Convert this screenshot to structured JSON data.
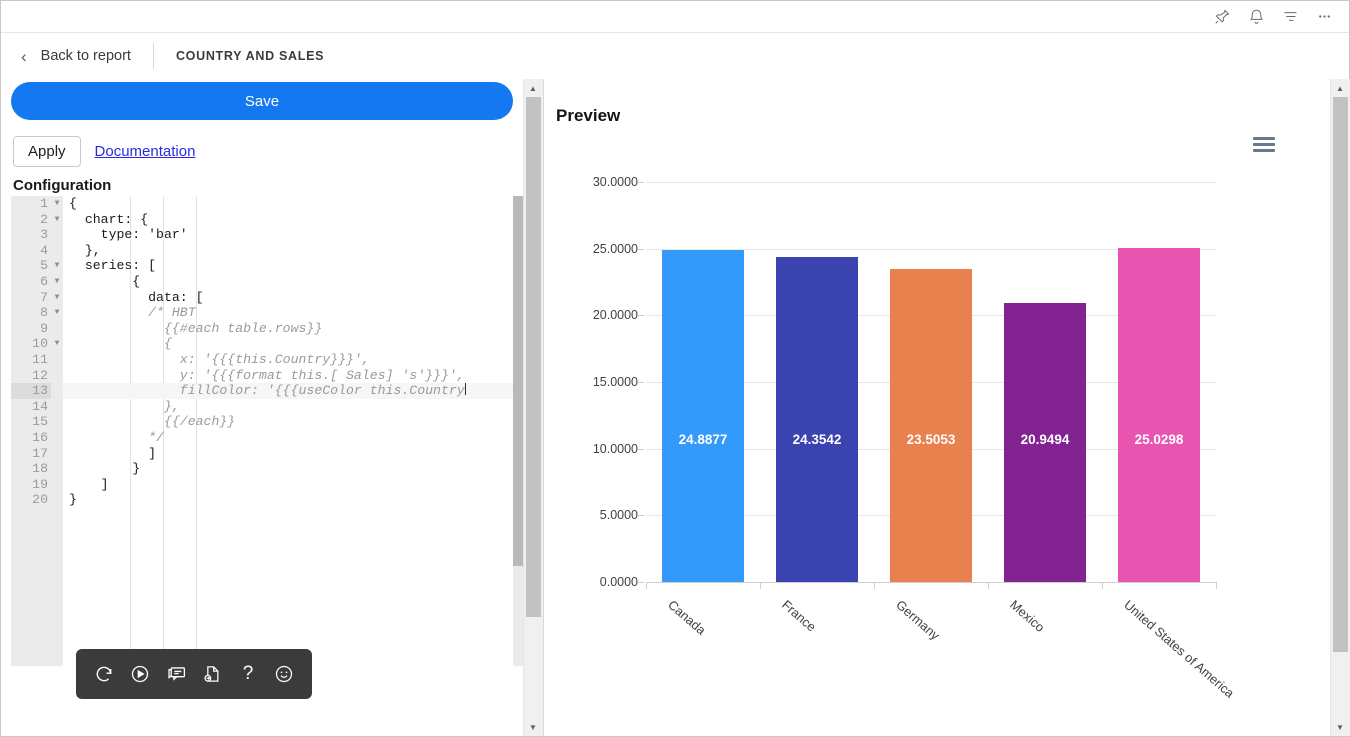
{
  "topbar": {
    "icons": [
      {
        "name": "pin-icon",
        "label": "Pin"
      },
      {
        "name": "bell-icon",
        "label": "Notifications"
      },
      {
        "name": "filter-icon",
        "label": "Filter"
      },
      {
        "name": "more-options-icon",
        "label": "More options"
      }
    ]
  },
  "breadcrumb": {
    "back_label": "Back to report",
    "title": "COUNTRY AND SALES"
  },
  "left_panel": {
    "save_label": "Save",
    "apply_label": "Apply",
    "documentation_label": "Documentation",
    "configuration_label": "Configuration",
    "editor": {
      "active_line": 13,
      "lines": [
        {
          "n": "1",
          "fold": true,
          "text": "{",
          "style": "code"
        },
        {
          "n": "2",
          "fold": true,
          "text": "  chart: {",
          "style": "code"
        },
        {
          "n": "3",
          "fold": false,
          "text": "    type: 'bar'",
          "style": "code"
        },
        {
          "n": "4",
          "fold": false,
          "text": "  },",
          "style": "code"
        },
        {
          "n": "5",
          "fold": true,
          "text": "  series: [",
          "style": "code"
        },
        {
          "n": "6",
          "fold": true,
          "text": "        {",
          "style": "code"
        },
        {
          "n": "7",
          "fold": true,
          "text": "          data: [",
          "style": "code"
        },
        {
          "n": "8",
          "fold": true,
          "text": "          /* HBT",
          "style": "comment"
        },
        {
          "n": "9",
          "fold": false,
          "text": "            {{#each table.rows}}",
          "style": "comment"
        },
        {
          "n": "10",
          "fold": true,
          "text": "            {",
          "style": "comment"
        },
        {
          "n": "11",
          "fold": false,
          "text": "              x: '{{{this.Country}}}',",
          "style": "comment"
        },
        {
          "n": "12",
          "fold": false,
          "text": "              y: '{{{format this.[ Sales] 's'}}}',",
          "style": "comment"
        },
        {
          "n": "13",
          "fold": false,
          "text": "              fillColor: '{{{useColor this.Country",
          "style": "comment"
        },
        {
          "n": "14",
          "fold": false,
          "text": "            },",
          "style": "comment"
        },
        {
          "n": "15",
          "fold": false,
          "text": "            {{/each}}",
          "style": "comment"
        },
        {
          "n": "16",
          "fold": false,
          "text": "          */",
          "style": "comment"
        },
        {
          "n": "17",
          "fold": false,
          "text": "          ]",
          "style": "code"
        },
        {
          "n": "18",
          "fold": false,
          "text": "        }",
          "style": "code"
        },
        {
          "n": "19",
          "fold": false,
          "text": "    ]",
          "style": "code"
        },
        {
          "n": "20",
          "fold": false,
          "text": "}",
          "style": "code"
        }
      ]
    },
    "toolbar_icons": [
      {
        "name": "refresh-icon",
        "label": "Refresh"
      },
      {
        "name": "run-icon",
        "label": "Run"
      },
      {
        "name": "comment-icon",
        "label": "Comment"
      },
      {
        "name": "export-file-icon",
        "label": "Export"
      },
      {
        "name": "help-icon",
        "label": "?"
      },
      {
        "name": "emoji-icon",
        "label": "Emoji"
      }
    ]
  },
  "right_panel": {
    "preview_label": "Preview",
    "context_menu_label": "Chart context menu"
  },
  "chart_data": {
    "type": "bar",
    "title": "",
    "xlabel": "",
    "ylabel": "",
    "ylim": [
      0,
      30
    ],
    "yticks": [
      "0.0000",
      "5.0000",
      "10.0000",
      "15.0000",
      "20.0000",
      "25.0000",
      "30.0000"
    ],
    "ytick_values": [
      0,
      5,
      10,
      15,
      20,
      25,
      30
    ],
    "grid": true,
    "legend": "none",
    "categories": [
      "Canada",
      "France",
      "Germany",
      "Mexico",
      "United States of America"
    ],
    "values": [
      24.8877,
      24.3542,
      23.5053,
      20.9494,
      25.0298
    ],
    "value_labels": [
      "24.8877",
      "24.3542",
      "23.5053",
      "20.9494",
      "25.0298"
    ],
    "colors": [
      "#3399fa",
      "#3a43b0",
      "#e8814e",
      "#822391",
      "#e755b0"
    ]
  }
}
